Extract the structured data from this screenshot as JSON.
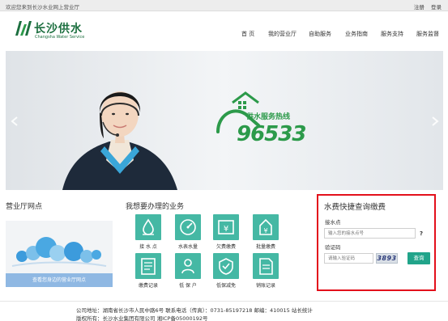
{
  "topbar": {
    "welcome": "欢迎您来到长沙水业网上营业厅",
    "register": "注册",
    "login": "登录"
  },
  "brand": {
    "name_cn": "长沙供水",
    "name_en": "Changsha Water Service",
    "color": "#1c6f3f"
  },
  "nav": {
    "items": [
      {
        "label": "首 页"
      },
      {
        "label": "我的营业厅"
      },
      {
        "label": "自助服务"
      },
      {
        "label": "业务指南"
      },
      {
        "label": "服务支持"
      },
      {
        "label": "服务监督"
      }
    ]
  },
  "banner": {
    "hotline_label": "供水服务热线",
    "hotline_number": "96533",
    "accent": "#2c9a4a",
    "prev_icon": "chevron-left-icon",
    "next_icon": "chevron-right-icon"
  },
  "outlets": {
    "title": "营业厅网点",
    "link": "查看您身边的营业厅网点"
  },
  "services": {
    "title": "我想要办理的业务",
    "items": [
      {
        "label": "接 水 点",
        "icon": "water-point-icon"
      },
      {
        "label": "水表水量",
        "icon": "water-meter-icon"
      },
      {
        "label": "欠费缴费",
        "icon": "pay-fee-icon"
      },
      {
        "label": "批量缴费",
        "icon": "batch-pay-icon"
      },
      {
        "label": "缴费记录",
        "icon": "payment-record-icon"
      },
      {
        "label": "低 保 户",
        "icon": "low-income-icon"
      },
      {
        "label": "低保减免",
        "icon": "reduction-icon"
      },
      {
        "label": "销账记录",
        "icon": "writeoff-record-icon"
      }
    ],
    "icon_color": "#45b8a4"
  },
  "quick_query": {
    "title": "水费快捷查询缴费",
    "account_label": "接水点",
    "account_placeholder": "输入您的接水点号",
    "help": "?",
    "captcha_label": "验证码",
    "captcha_placeholder": "请输入验证码",
    "captcha_text": "3893",
    "submit": "查询",
    "border_color": "#e3101b",
    "button_color": "#21a48a"
  },
  "footer": {
    "line1": "公司地址：湖南省长沙市人民中路6号   联系电话（传真）：0731-85197218     邮编：410015 站长统计",
    "line2": "版权所有：长沙水业集团有限公司        湘ICP备05000192号"
  }
}
